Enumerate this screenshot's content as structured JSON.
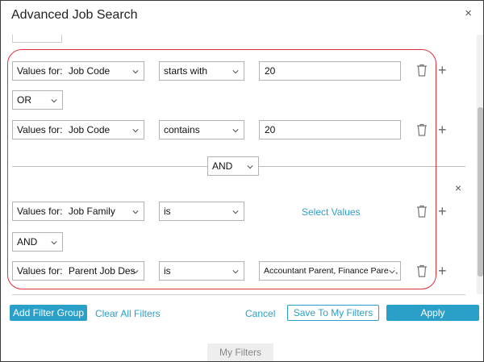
{
  "dialog": {
    "title": "Advanced Job Search",
    "close_glyph": "×"
  },
  "group1": {
    "row1": {
      "prefix": "Values for:",
      "field": "Job Code",
      "operator": "starts with",
      "value": "20"
    },
    "connector": "OR",
    "row2": {
      "prefix": "Values for:",
      "field": "Job Code",
      "operator": "contains",
      "value": "20"
    }
  },
  "group_connector": "AND",
  "group2": {
    "close_glyph": "×",
    "row1": {
      "prefix": "Values for:",
      "field": "Job Family",
      "operator": "is",
      "select_values_label": "Select Values"
    },
    "connector": "AND",
    "row2": {
      "prefix": "Values for:",
      "field": "Parent Job Des",
      "operator": "is",
      "value": "Accountant Parent, Finance Parent, I"
    }
  },
  "plus_glyph": "+",
  "footer": {
    "add_filter_group": "Add Filter Group",
    "clear_all_filters": "Clear All Filters",
    "cancel": "Cancel",
    "save_to_my_filters": "Save To My Filters",
    "apply": "Apply",
    "my_filters_tab": "My Filters"
  },
  "colors": {
    "accent": "#2aa0c8",
    "highlight": "#e0303a"
  }
}
